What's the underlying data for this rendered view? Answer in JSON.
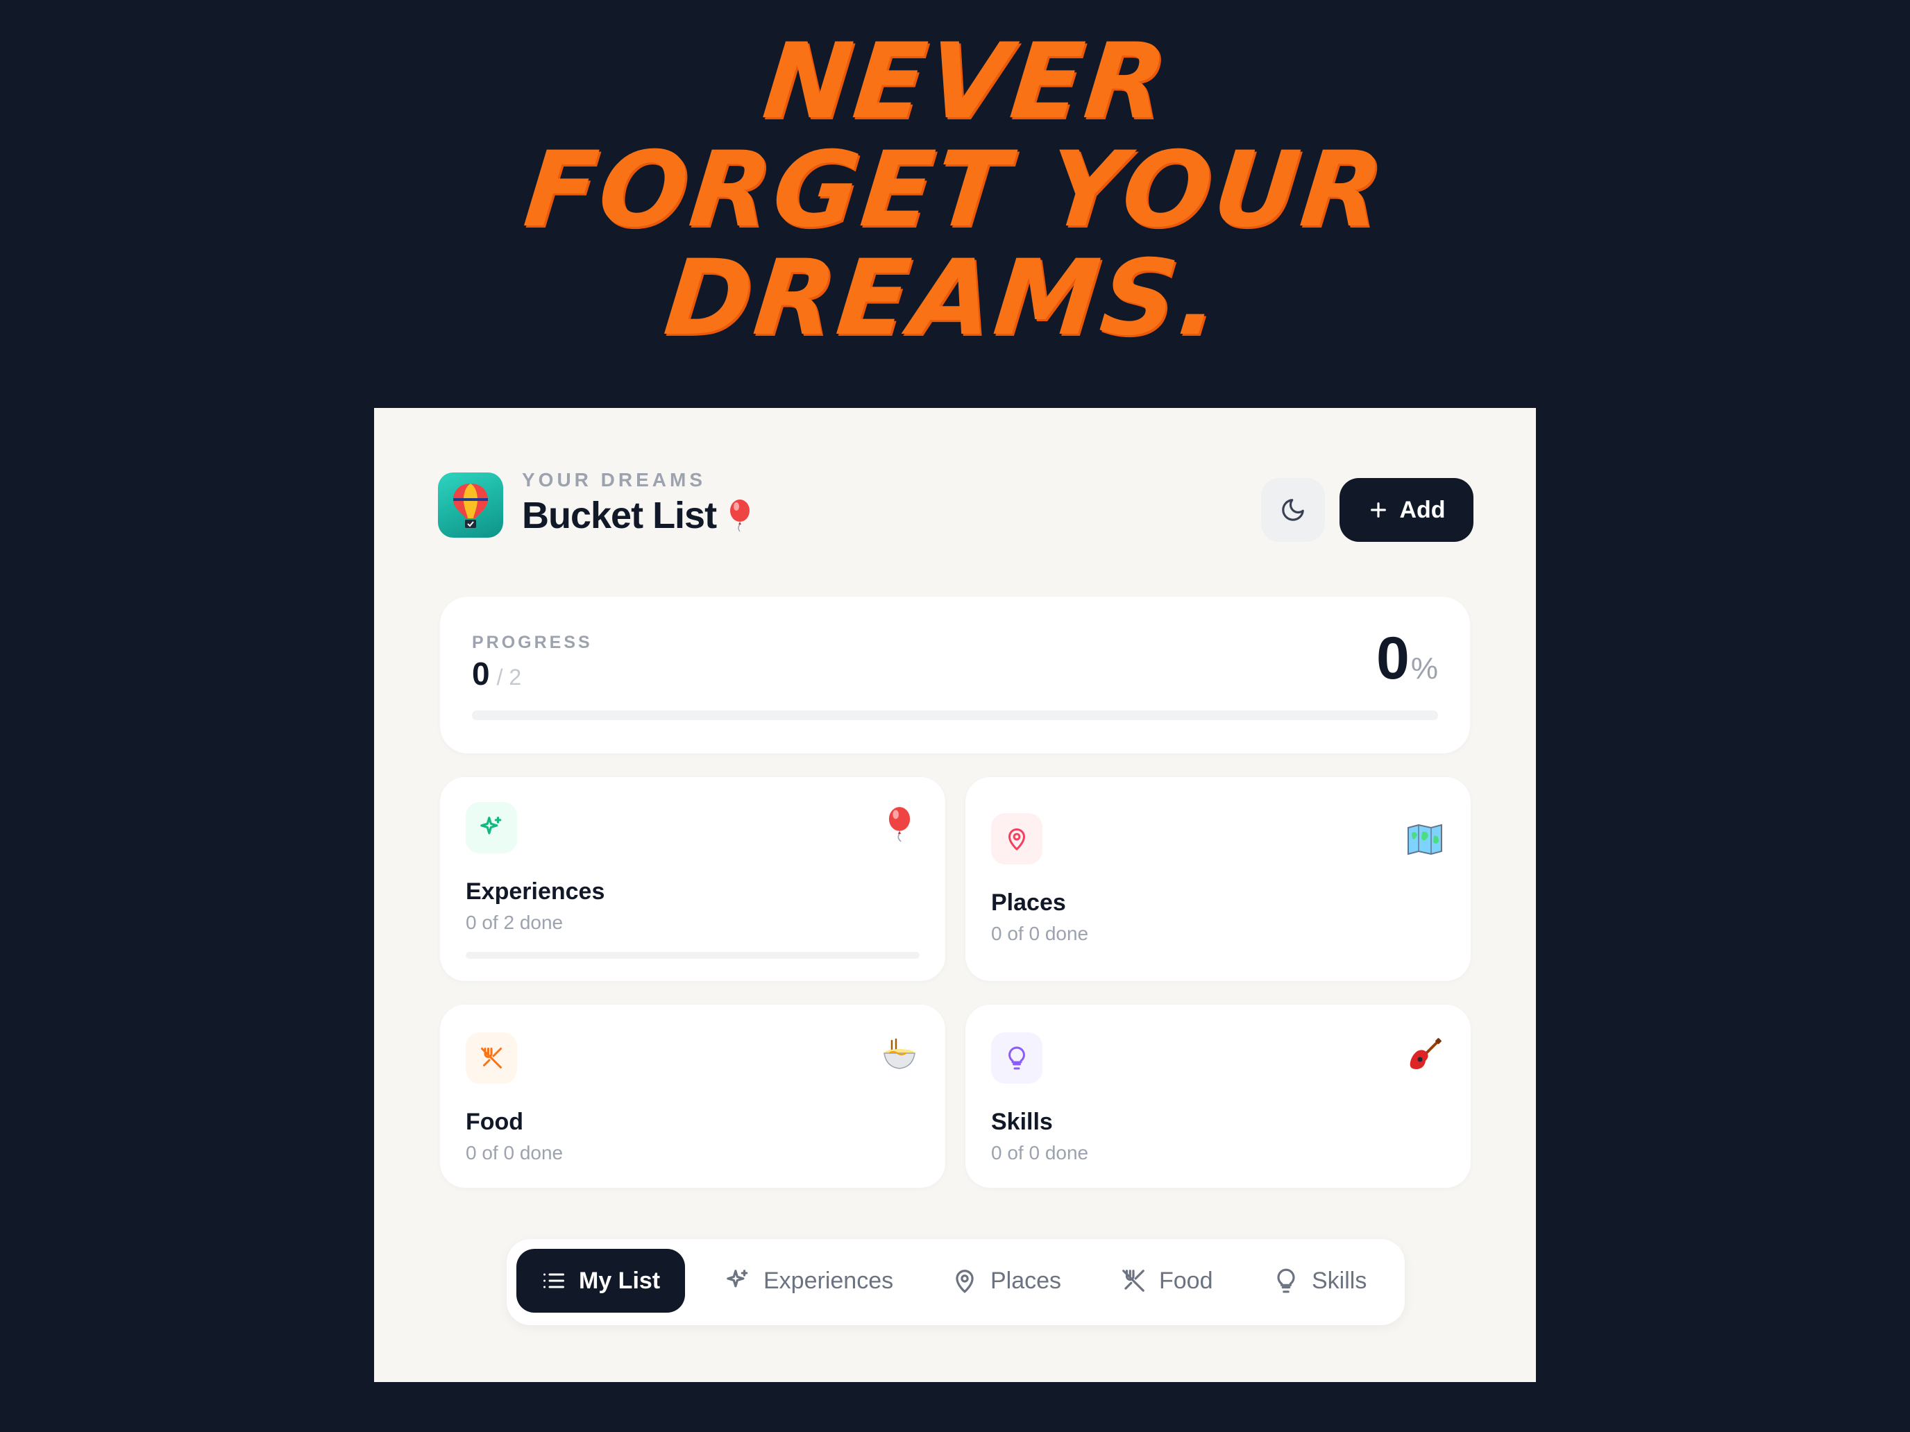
{
  "headline": {
    "line1": "Never",
    "line2": "Forget your",
    "line3": "Dreams."
  },
  "header": {
    "eyebrow": "YOUR DREAMS",
    "title": "Bucket List",
    "title_emoji": "balloon",
    "add_label": "Add"
  },
  "progress": {
    "label": "PROGRESS",
    "done": "0",
    "total": "/ 2",
    "percent": "0",
    "percent_sign": "%",
    "fraction": 0
  },
  "categories": [
    {
      "name": "Experiences",
      "sub": "0 of 2 done",
      "icon": "sparkles-icon",
      "emoji": "balloon",
      "fraction": 0,
      "accent": "#10b981"
    },
    {
      "name": "Places",
      "sub": "0 of 0 done",
      "icon": "map-pin-icon",
      "emoji": "world-map",
      "accent": "#f43f5e"
    },
    {
      "name": "Food",
      "sub": "0 of 0 done",
      "icon": "utensils-icon",
      "emoji": "noodle-bowl",
      "accent": "#f97316"
    },
    {
      "name": "Skills",
      "sub": "0 of 0 done",
      "icon": "lightbulb-icon",
      "emoji": "guitar",
      "accent": "#8b5cf6"
    }
  ],
  "nav": {
    "items": [
      {
        "label": "My List",
        "icon": "list-icon",
        "active": true
      },
      {
        "label": "Experiences",
        "icon": "sparkles-icon"
      },
      {
        "label": "Places",
        "icon": "map-pin-icon"
      },
      {
        "label": "Food",
        "icon": "utensils-icon"
      },
      {
        "label": "Skills",
        "icon": "lightbulb-icon"
      }
    ]
  },
  "colors": {
    "background": "#111827",
    "headline": "#f97316",
    "panel": "#f7f6f3",
    "primary": "#111827"
  }
}
